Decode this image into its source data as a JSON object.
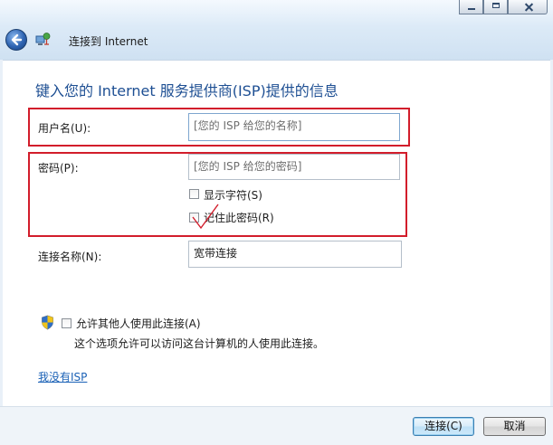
{
  "window": {
    "title": "连接到 Internet"
  },
  "heading": "键入您的 Internet 服务提供商(ISP)提供的信息",
  "username": {
    "label": "用户名(U):",
    "placeholder": "[您的 ISP 给您的名称]"
  },
  "password": {
    "label": "密码(P):",
    "placeholder": "[您的 ISP 给您的密码]"
  },
  "show_chars": {
    "label": "显示字符(S)",
    "checked": false
  },
  "remember_password": {
    "label": "记住此密码(R)",
    "checked": false
  },
  "connection_name": {
    "label": "连接名称(N):",
    "value": "宽带连接"
  },
  "allow_others": {
    "label": "允许其他人使用此连接(A)",
    "description": "这个选项允许可以访问这台计算机的人使用此连接。",
    "checked": false
  },
  "no_isp_link": "我没有ISP",
  "buttons": {
    "connect": "连接(C)",
    "cancel": "取消"
  },
  "annotation_color": "#d21d2b",
  "icons": {
    "back": "back-arrow-icon",
    "network": "network-connection-icon",
    "shield": "uac-shield-icon",
    "checkmark": "red-checkmark-annotation-icon"
  }
}
